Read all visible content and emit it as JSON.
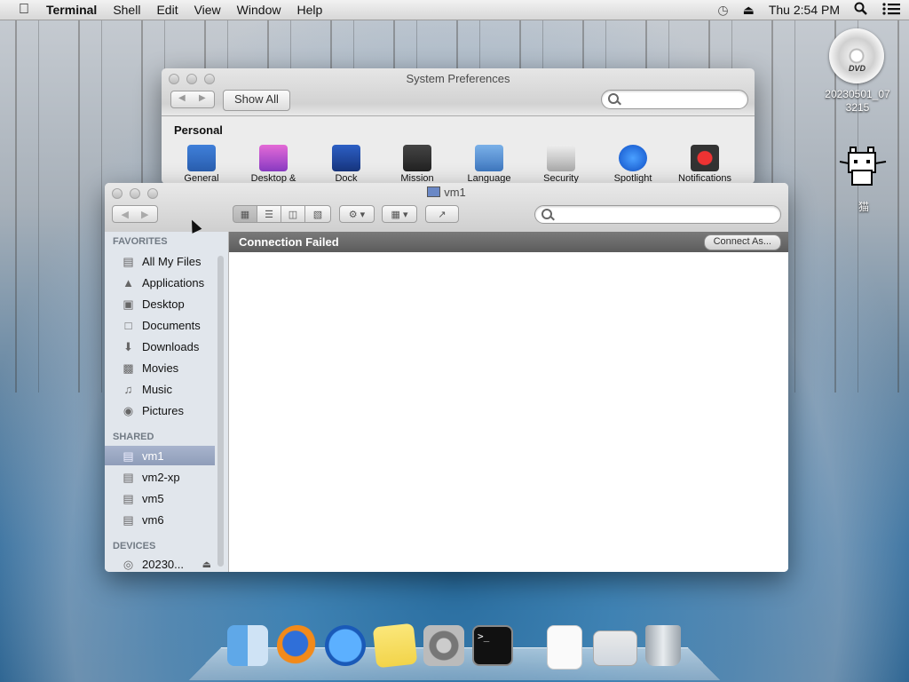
{
  "menubar": {
    "app": "Terminal",
    "items": [
      "Shell",
      "Edit",
      "View",
      "Window",
      "Help"
    ],
    "clock": "Thu 2:54 PM"
  },
  "desktop": {
    "dvd_label": "20230501_07\n3215",
    "dvd_badge": "DVD",
    "cat_label": "猫"
  },
  "sysprefs": {
    "title": "System Preferences",
    "show_all": "Show All",
    "section": "Personal",
    "items": [
      "General",
      "Desktop &",
      "Dock",
      "Mission",
      "Language",
      "Security",
      "Spotlight",
      "Notifications"
    ]
  },
  "finder": {
    "title": "vm1",
    "banner": "Connection Failed",
    "connect_button": "Connect As...",
    "favorites_header": "FAVORITES",
    "favorites": [
      "All My Files",
      "Applications",
      "Desktop",
      "Documents",
      "Downloads",
      "Movies",
      "Music",
      "Pictures"
    ],
    "shared_header": "SHARED",
    "shared": [
      "vm1",
      "vm2-xp",
      "vm5",
      "vm6"
    ],
    "devices_header": "DEVICES",
    "devices": [
      "20230..."
    ]
  },
  "dock": {
    "apps": [
      "finder",
      "firefox",
      "app-store",
      "stickies",
      "system-preferences",
      "terminal",
      "document",
      "preview",
      "trash"
    ]
  }
}
